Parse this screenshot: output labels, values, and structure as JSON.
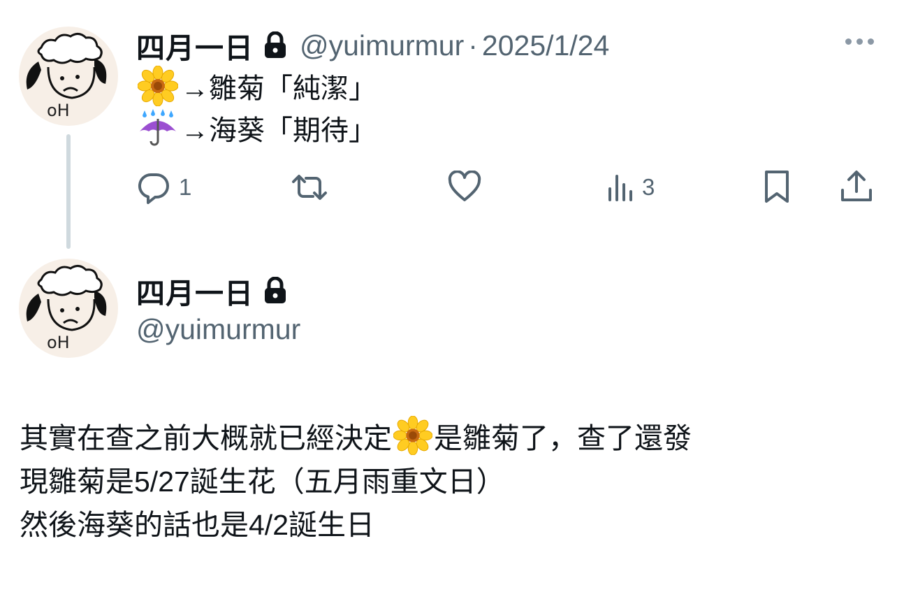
{
  "parent_tweet": {
    "author_name": "四月一日",
    "handle": "@yuimurmur",
    "separator": "·",
    "date": "2025/1/24",
    "lines": [
      {
        "emoji": "sunflower-icon",
        "text": "→雛菊「純潔」"
      },
      {
        "emoji": "umbrella-rain-icon",
        "text": "→海葵「期待」"
      }
    ],
    "actions": {
      "reply_count": "1",
      "repost_count": "",
      "like_count": "",
      "views_count": "3"
    }
  },
  "main_tweet": {
    "author_name": "四月一日",
    "handle": "@yuimurmur",
    "body_lines": [
      {
        "before": "其實在查之前大概就已經決定",
        "emoji": "sunflower-icon",
        "after": "是雛菊了，查了還發"
      },
      {
        "text": "現雛菊是5/27誕生花（五月雨重文日）"
      },
      {
        "text": "然後海葵的話也是4/2誕生日"
      }
    ]
  },
  "avatar": {
    "label": "oH",
    "bg": "#f7efe7"
  },
  "colors": {
    "text": "#0f1419",
    "secondary": "#536471",
    "thread_line": "#cfd9de"
  }
}
